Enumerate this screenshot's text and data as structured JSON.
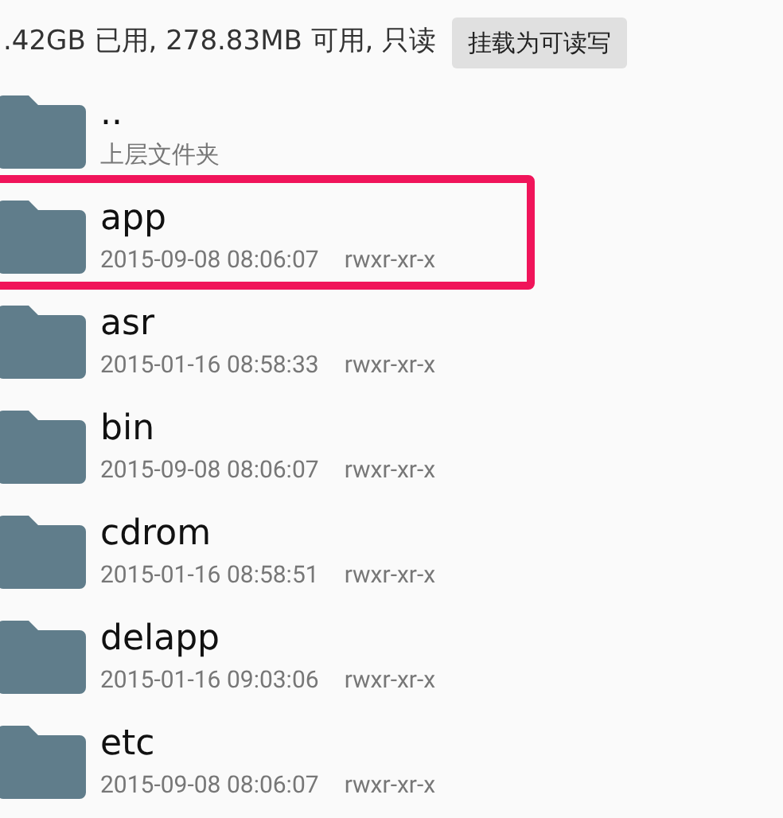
{
  "storage_bar": {
    "status": ".42GB 已用, 278.83MB 可用, 只读",
    "mount_button": "挂载为可读写"
  },
  "files": [
    {
      "name": "..",
      "detail": "上层文件夹",
      "highlighted": false
    },
    {
      "name": "app",
      "date": "2015-09-08 08:06:07",
      "permissions": "rwxr-xr-x",
      "highlighted": true
    },
    {
      "name": "asr",
      "date": "2015-01-16 08:58:33",
      "permissions": "rwxr-xr-x",
      "highlighted": false
    },
    {
      "name": "bin",
      "date": "2015-09-08 08:06:07",
      "permissions": "rwxr-xr-x",
      "highlighted": false
    },
    {
      "name": "cdrom",
      "date": "2015-01-16 08:58:51",
      "permissions": "rwxr-xr-x",
      "highlighted": false
    },
    {
      "name": "delapp",
      "date": "2015-01-16 09:03:06",
      "permissions": "rwxr-xr-x",
      "highlighted": false
    },
    {
      "name": "etc",
      "date": "2015-09-08 08:06:07",
      "permissions": "rwxr-xr-x",
      "highlighted": false
    }
  ]
}
